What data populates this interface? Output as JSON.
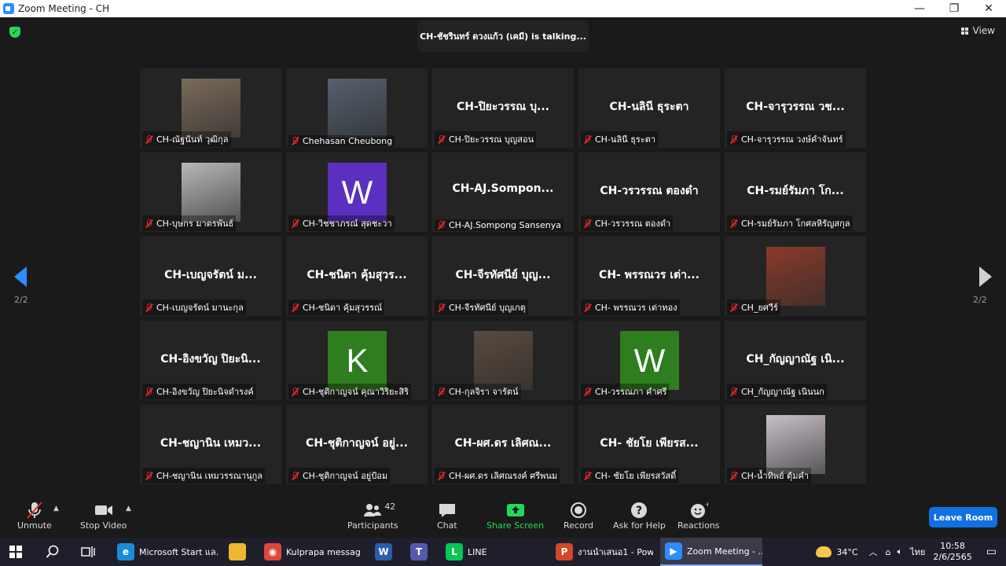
{
  "window": {
    "title": "Zoom Meeting - CH",
    "controls": [
      "—",
      "❐",
      "✕"
    ]
  },
  "meeting": {
    "talking_indicator": "CH-ชัชรินทร์ ดวงแก้ว (เคมี) is  talking...",
    "view_label": "View",
    "page_indicator_left": "2/2",
    "page_indicator_right": "2/2"
  },
  "participants_tiles": [
    {
      "display": "video",
      "label": "CH-ณัฐนันท์ วุฒิกุล",
      "video_color": "#7a6a5a"
    },
    {
      "display": "video",
      "label": "Chehasan Cheubong",
      "video_color": "#55606e"
    },
    {
      "display": "name",
      "big_name": "CH-ปิยะวรรณ บุ...",
      "label": "CH-ปิยะวรรณ บุญสอน"
    },
    {
      "display": "name",
      "big_name": "CH-นลินี ธุระตา",
      "label": "CH-นลินี ธุระตา"
    },
    {
      "display": "name",
      "big_name": "CH-จารุวรรณ วช...",
      "label": "CH-จารุวรรณ วงษ์คำจันทร์"
    },
    {
      "display": "video",
      "label": "CH-บุษกร มาตรพันธ์",
      "video_color": "#b8b8b8"
    },
    {
      "display": "avatar",
      "letter": "W",
      "avatar_color": "#5b2fc0",
      "label": "CH-วิชชาภรณ์ สุดชะวา"
    },
    {
      "display": "name",
      "big_name": "CH-AJ.Sompon...",
      "label": "CH-AJ.Sompong Sansenya"
    },
    {
      "display": "name",
      "big_name": "CH-วรวรรณ ตองดำ",
      "label": "CH-วรวรรณ ตองดำ"
    },
    {
      "display": "name",
      "big_name": "CH-รมย์รัมภา โก...",
      "label": "CH-รมย์รัมภา โกศลหิรัญสกุล"
    },
    {
      "display": "name",
      "big_name": "CH-เบญจรัตน์ ม...",
      "label": "CH-เบญจรัตน์ มานะกุล"
    },
    {
      "display": "name",
      "big_name": "CH-ชนิดา คุ้มสุวร...",
      "label": "CH-ชนิดา คุ้มสุวรรณ์"
    },
    {
      "display": "name",
      "big_name": "CH-จีรทัศนีย์ บุญ...",
      "label": "CH-จีรทัศนีย์ บุญเกตุ"
    },
    {
      "display": "name",
      "big_name": "CH- พรรณวร เต่า...",
      "label": "CH- พรรณวร เต่าทอง"
    },
    {
      "display": "video",
      "label": "CH_ยศวีร์",
      "video_color": "#8a3a2a"
    },
    {
      "display": "name",
      "big_name": "CH-อิงขวัญ ปิยะนิ...",
      "label": "CH-อิงขวัญ ปิยะนิจดำรงค์"
    },
    {
      "display": "avatar",
      "letter": "K",
      "avatar_color": "#2e7d1e",
      "label": "CH-ชุติกาญจน์ คุณาวิริยะสิริ"
    },
    {
      "display": "video",
      "label": "CH-กุลจิรา จารัตน์",
      "video_color": "#5a4a3e"
    },
    {
      "display": "avatar",
      "letter": "W",
      "avatar_color": "#2e7d1e",
      "label": "CH-วรรณภา คำศรี"
    },
    {
      "display": "name",
      "big_name": "CH_กัญญาณัฐ เนิ...",
      "label": "CH_กัญญาณัฐ เนินนก"
    },
    {
      "display": "name",
      "big_name": "CH-ชญานิน เหมว...",
      "label": "CH-ชญานิน เหมวรรณานุกูล"
    },
    {
      "display": "name",
      "big_name": "CH-ชุติกาญจน์ อยู่...",
      "label": "CH-ชุติกาญจน์ อยู่ป้อม"
    },
    {
      "display": "name",
      "big_name": "CH-ผศ.ดร เลิศณ...",
      "label": "CH-ผศ.ดร เลิศณรงค์ ศรีพนม"
    },
    {
      "display": "name",
      "big_name": "CH- ชัยโย เพียรส...",
      "label": "CH- ชัยโย เพียรสวัสดิ์"
    },
    {
      "display": "video",
      "label": "CH-น้ำทิพย์ ตุ้มคำ",
      "video_color": "#c9c0c8"
    }
  ],
  "toolbar": {
    "unmute": "Unmute",
    "stop_video": "Stop Video",
    "participants": "Participants",
    "participants_count": "42",
    "chat": "Chat",
    "share_screen": "Share Screen",
    "record": "Record",
    "ask_for_help": "Ask for Help",
    "reactions": "Reactions",
    "leave_room": "Leave Room",
    "share_color": "#23d959",
    "leave_color": "#1170e3"
  },
  "taskbar": {
    "apps": [
      {
        "label": "Microsoft Start แล...",
        "icon": "edge-icon",
        "color": "#1b8ad9",
        "glyph": "e"
      },
      {
        "label": "",
        "icon": "folder-icon",
        "color": "#f0b630",
        "glyph": ""
      },
      {
        "label": "Kulprapa messag...",
        "icon": "chrome-icon",
        "color": "#e0463a",
        "glyph": "◉"
      },
      {
        "label": "",
        "icon": "word-icon",
        "color": "#2b5caf",
        "glyph": "W"
      },
      {
        "label": "",
        "icon": "teams-icon",
        "color": "#5558af",
        "glyph": "T"
      },
      {
        "label": "LINE",
        "icon": "line-icon",
        "color": "#06c755",
        "glyph": "L"
      },
      {
        "label": "งานนำเสนอ1 - Pow...",
        "icon": "powerpoint-icon",
        "color": "#d24726",
        "glyph": "P"
      },
      {
        "label": "Zoom Meeting - ...",
        "icon": "zoom-icon",
        "color": "#2d8cff",
        "glyph": "▶"
      }
    ],
    "temperature": "34°C",
    "language": "ไทย",
    "time": "10:58",
    "date": "2/6/2565"
  }
}
